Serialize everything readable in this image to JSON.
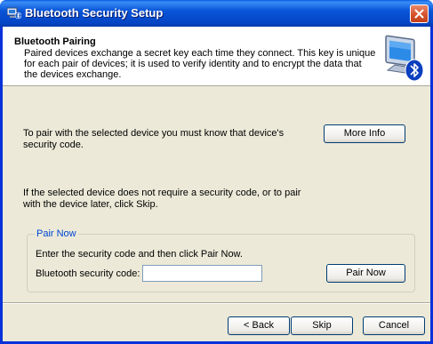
{
  "window": {
    "title": "Bluetooth Security Setup"
  },
  "icons": {
    "app": "bluetooth-app-icon",
    "close": "close-icon",
    "header": "bluetooth-computer-icon"
  },
  "header": {
    "title": "Bluetooth Pairing",
    "description": "Paired devices exchange a secret key each time they connect. This key is unique for each pair of devices; it is used to verify identity and to encrypt the data that the devices exchange."
  },
  "body": {
    "security_code_text": "To pair with the selected device you must know that device's security code.",
    "more_info_label": "More Info",
    "skip_text": "If the selected device does not require a security code, or to pair with the device later, click Skip."
  },
  "pair_now_group": {
    "legend": "Pair Now",
    "instructions": "Enter the security code and then click Pair Now.",
    "code_label": "Bluetooth security code:",
    "code_value": "",
    "pair_now_label": "Pair Now"
  },
  "footer": {
    "back_label": "< Back",
    "skip_label": "Skip",
    "cancel_label": "Cancel"
  },
  "colors": {
    "titlebar": "#0a55d8",
    "dialog_background": "#ece9d8",
    "group_legend": "#0046d5",
    "close_button": "#d6512c"
  }
}
